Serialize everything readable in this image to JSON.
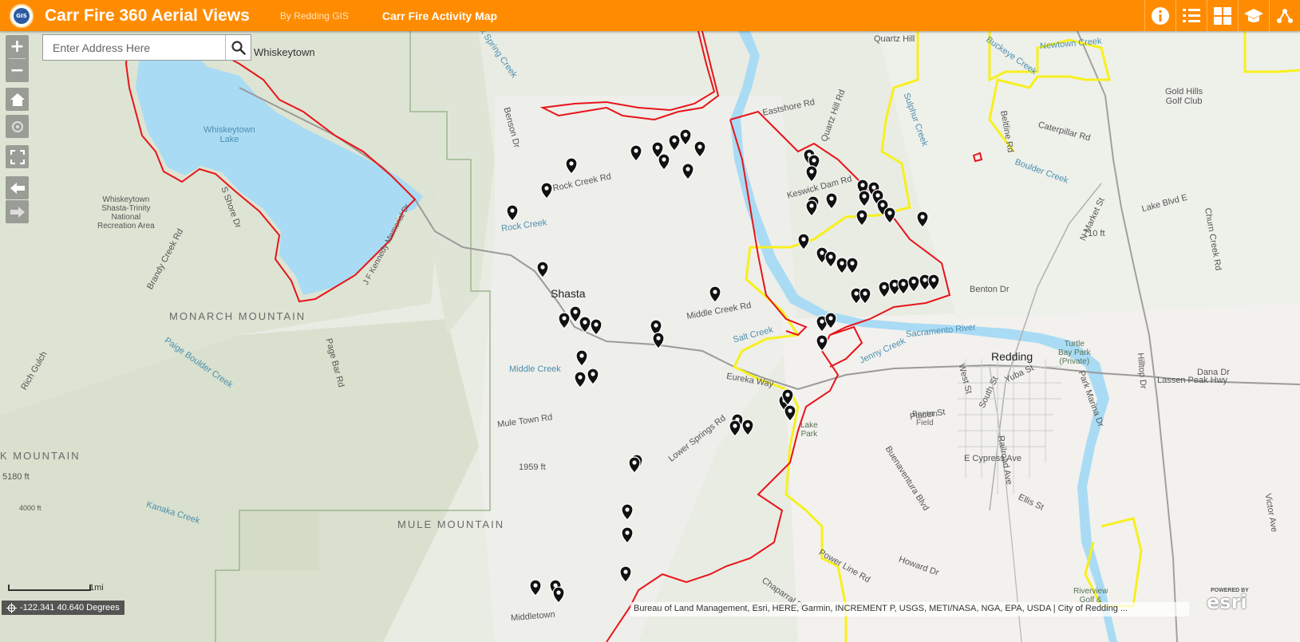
{
  "header": {
    "title": "Carr Fire 360 Aerial Views",
    "byline": "By Redding GIS",
    "subtitle": "Carr Fire Activity Map",
    "logo_text": "GIS",
    "tools": [
      "info-icon",
      "legend-list-icon",
      "basemap-gallery-icon",
      "about-graduation-cap-icon",
      "share-icon"
    ]
  },
  "search": {
    "placeholder": "Enter Address Here",
    "value": ""
  },
  "map_controls": [
    "zoom-in",
    "zoom-out",
    "home",
    "locate",
    "fullscreen",
    "previous-extent",
    "next-extent"
  ],
  "zoom": {
    "in_label": "+",
    "out_label": "−"
  },
  "coordinates": "-122.341 40.640 Degrees",
  "scale": "1mi",
  "attribution": "Bureau of Land Management, Esri, HERE, Garmin, INCREMENT P, USGS, METI/NASA, NGA, EPA, USDA | City of Redding ...",
  "esri": {
    "powered_by": "POWERED BY",
    "name": "esri"
  },
  "colors": {
    "header": "#ff8c00",
    "fire_perimeter": "#e8141a",
    "city_limits": "#f7f01e",
    "water": "#a9dbf4",
    "marker": "#111111"
  },
  "map_labels": {
    "whiskeytown": "Whiskeytown",
    "whiskeytown_lake": "Whiskeytown\nLake",
    "recreation_area": "Whiskeytown\nShasta-Trinity\nNational\nRecreation Area",
    "shasta": "Shasta",
    "redding": "Redding",
    "monarch": "MONARCH MOUNTAIN",
    "mule_mountain": "MULE MOUNTAIN",
    "k_mountain": "K MOUNTAIN",
    "quartz_hill": "Quartz Hill",
    "newtown_creek": "Newtown Creek",
    "gold_hills": "Gold Hills\nGolf Club",
    "sacramento_river": "Sacramento River",
    "benton_dr": "Benton Dr",
    "turtle_bay": "Turtle\nBay Park\n(Private)",
    "lake_park": "Lake\nPark",
    "benton_field": "Benton\nField",
    "e_cypress": "E Cypress Ave",
    "lassen_peak": "Lassen Peak Hwy",
    "keswick_dam": "Keswick Dam Rd",
    "eastshore": "Eastshore Rd",
    "rock_creek_rd": "Rock Creek Rd",
    "rock_creek": "Rock Creek",
    "middle_creek": "Middle Creek",
    "middle_creek_rd": "Middle Creek Rd",
    "salt_creek": "Salt Creek",
    "jenny_creek": "Jenny Creek",
    "eureka_way": "Eureka Way",
    "mule_town_rd": "Mule Town Rd",
    "lower_springs": "Lower Springs Rd",
    "kanaka_creek": "Kanaka Creek",
    "paige_boulder": "Paige Boulder Creek",
    "rich_gulch": "Rich Gulch",
    "brandy_creek": "Brandy Creek Rd",
    "fork_spring": "Fork Spring Creek",
    "boulder_creek": "Boulder Creek",
    "sulphur_creek": "Sulphur Creek",
    "buckeye_creek": "Buckeye Creek",
    "caterpillar": "Caterpillar Rd",
    "lake_blvd": "Lake Blvd E",
    "churn_creek": "Churn Creek Rd",
    "n_market": "N Market St",
    "placer": "Placer St",
    "riverview": "Riverview\nGolf &",
    "howard": "Howard Dr",
    "victor": "Victor Ave",
    "dana": "Dana Dr",
    "elevation_710": "710 ft",
    "elevation_1959": "1959 ft",
    "elevation_5180": "5180 ft",
    "elevation_4000": "4000 ft",
    "middletown": "Middletown",
    "shore_dr": "S Shore Dr",
    "kennedy": "J F Kennedy Memorial Dr",
    "benson": "Benson Dr",
    "quartz_hill_rd": "Quartz Hill Rd",
    "yuba": "Yuba St",
    "south_st": "South St",
    "west_st": "West St",
    "railroad": "Railroad Ave",
    "hilltop": "Hilltop Dr",
    "buenaventura": "Buenaventura Blvd",
    "ellis": "Ellis St",
    "park_marina": "Park Marina Dr",
    "beltline": "Beltline Rd",
    "page_bar": "Page Bar Rd",
    "chaparral": "Chaparral Dr",
    "power_line": "Power Line Rd"
  },
  "fire_photo_markers": [
    "photo-point",
    "photo-point",
    "photo-point",
    "photo-point",
    "photo-point"
  ]
}
